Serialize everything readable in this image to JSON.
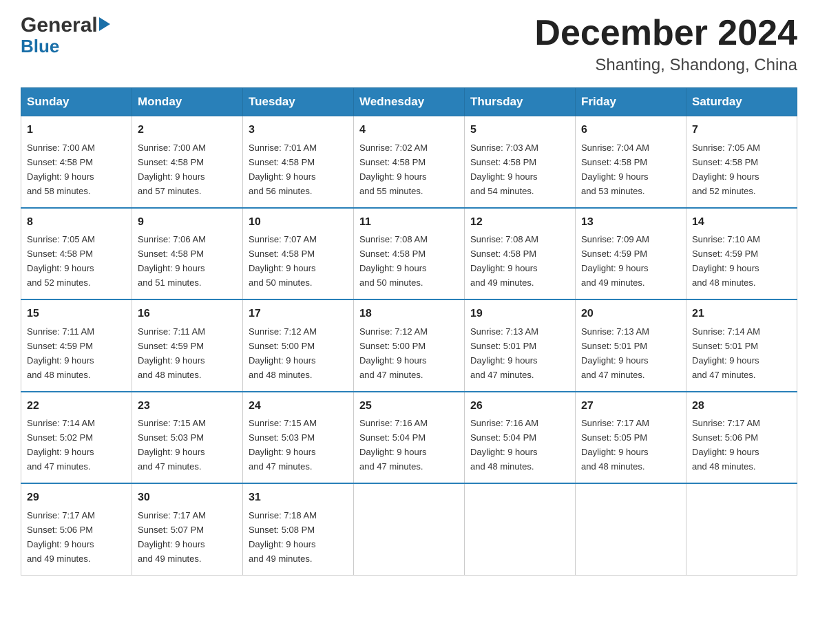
{
  "header": {
    "logo_general": "General",
    "logo_blue": "Blue",
    "month_year": "December 2024",
    "location": "Shanting, Shandong, China"
  },
  "days_of_week": [
    "Sunday",
    "Monday",
    "Tuesday",
    "Wednesday",
    "Thursday",
    "Friday",
    "Saturday"
  ],
  "weeks": [
    [
      {
        "day": "1",
        "sunrise": "7:00 AM",
        "sunset": "4:58 PM",
        "daylight": "9 hours and 58 minutes."
      },
      {
        "day": "2",
        "sunrise": "7:00 AM",
        "sunset": "4:58 PM",
        "daylight": "9 hours and 57 minutes."
      },
      {
        "day": "3",
        "sunrise": "7:01 AM",
        "sunset": "4:58 PM",
        "daylight": "9 hours and 56 minutes."
      },
      {
        "day": "4",
        "sunrise": "7:02 AM",
        "sunset": "4:58 PM",
        "daylight": "9 hours and 55 minutes."
      },
      {
        "day": "5",
        "sunrise": "7:03 AM",
        "sunset": "4:58 PM",
        "daylight": "9 hours and 54 minutes."
      },
      {
        "day": "6",
        "sunrise": "7:04 AM",
        "sunset": "4:58 PM",
        "daylight": "9 hours and 53 minutes."
      },
      {
        "day": "7",
        "sunrise": "7:05 AM",
        "sunset": "4:58 PM",
        "daylight": "9 hours and 52 minutes."
      }
    ],
    [
      {
        "day": "8",
        "sunrise": "7:05 AM",
        "sunset": "4:58 PM",
        "daylight": "9 hours and 52 minutes."
      },
      {
        "day": "9",
        "sunrise": "7:06 AM",
        "sunset": "4:58 PM",
        "daylight": "9 hours and 51 minutes."
      },
      {
        "day": "10",
        "sunrise": "7:07 AM",
        "sunset": "4:58 PM",
        "daylight": "9 hours and 50 minutes."
      },
      {
        "day": "11",
        "sunrise": "7:08 AM",
        "sunset": "4:58 PM",
        "daylight": "9 hours and 50 minutes."
      },
      {
        "day": "12",
        "sunrise": "7:08 AM",
        "sunset": "4:58 PM",
        "daylight": "9 hours and 49 minutes."
      },
      {
        "day": "13",
        "sunrise": "7:09 AM",
        "sunset": "4:59 PM",
        "daylight": "9 hours and 49 minutes."
      },
      {
        "day": "14",
        "sunrise": "7:10 AM",
        "sunset": "4:59 PM",
        "daylight": "9 hours and 48 minutes."
      }
    ],
    [
      {
        "day": "15",
        "sunrise": "7:11 AM",
        "sunset": "4:59 PM",
        "daylight": "9 hours and 48 minutes."
      },
      {
        "day": "16",
        "sunrise": "7:11 AM",
        "sunset": "4:59 PM",
        "daylight": "9 hours and 48 minutes."
      },
      {
        "day": "17",
        "sunrise": "7:12 AM",
        "sunset": "5:00 PM",
        "daylight": "9 hours and 48 minutes."
      },
      {
        "day": "18",
        "sunrise": "7:12 AM",
        "sunset": "5:00 PM",
        "daylight": "9 hours and 47 minutes."
      },
      {
        "day": "19",
        "sunrise": "7:13 AM",
        "sunset": "5:01 PM",
        "daylight": "9 hours and 47 minutes."
      },
      {
        "day": "20",
        "sunrise": "7:13 AM",
        "sunset": "5:01 PM",
        "daylight": "9 hours and 47 minutes."
      },
      {
        "day": "21",
        "sunrise": "7:14 AM",
        "sunset": "5:01 PM",
        "daylight": "9 hours and 47 minutes."
      }
    ],
    [
      {
        "day": "22",
        "sunrise": "7:14 AM",
        "sunset": "5:02 PM",
        "daylight": "9 hours and 47 minutes."
      },
      {
        "day": "23",
        "sunrise": "7:15 AM",
        "sunset": "5:03 PM",
        "daylight": "9 hours and 47 minutes."
      },
      {
        "day": "24",
        "sunrise": "7:15 AM",
        "sunset": "5:03 PM",
        "daylight": "9 hours and 47 minutes."
      },
      {
        "day": "25",
        "sunrise": "7:16 AM",
        "sunset": "5:04 PM",
        "daylight": "9 hours and 47 minutes."
      },
      {
        "day": "26",
        "sunrise": "7:16 AM",
        "sunset": "5:04 PM",
        "daylight": "9 hours and 48 minutes."
      },
      {
        "day": "27",
        "sunrise": "7:17 AM",
        "sunset": "5:05 PM",
        "daylight": "9 hours and 48 minutes."
      },
      {
        "day": "28",
        "sunrise": "7:17 AM",
        "sunset": "5:06 PM",
        "daylight": "9 hours and 48 minutes."
      }
    ],
    [
      {
        "day": "29",
        "sunrise": "7:17 AM",
        "sunset": "5:06 PM",
        "daylight": "9 hours and 49 minutes."
      },
      {
        "day": "30",
        "sunrise": "7:17 AM",
        "sunset": "5:07 PM",
        "daylight": "9 hours and 49 minutes."
      },
      {
        "day": "31",
        "sunrise": "7:18 AM",
        "sunset": "5:08 PM",
        "daylight": "9 hours and 49 minutes."
      },
      null,
      null,
      null,
      null
    ]
  ],
  "labels": {
    "sunrise": "Sunrise:",
    "sunset": "Sunset:",
    "daylight": "Daylight:"
  }
}
